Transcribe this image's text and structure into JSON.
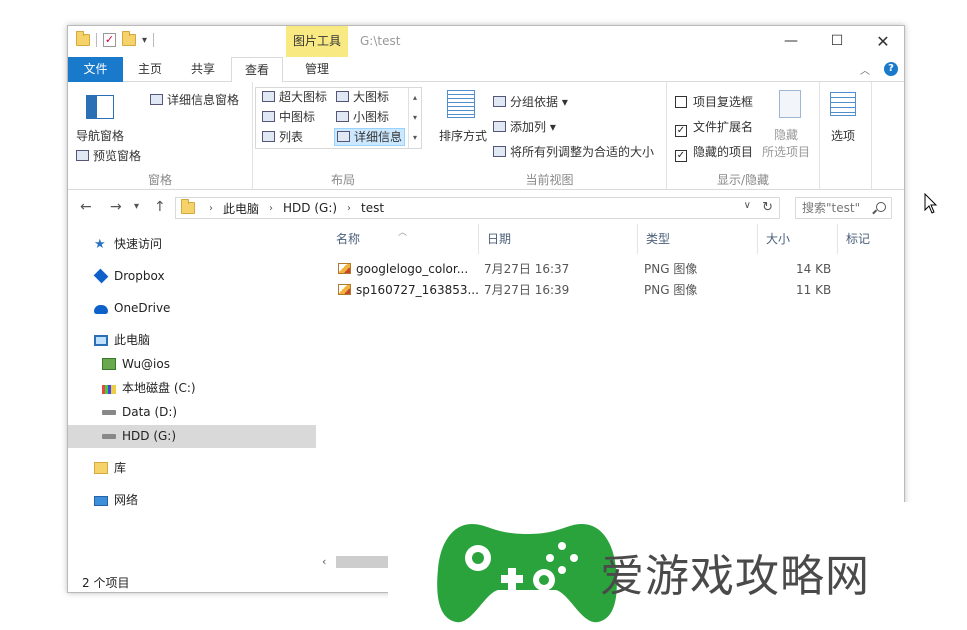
{
  "window": {
    "context_tab": "图片工具",
    "title": "G:\\test"
  },
  "tabs": {
    "file": "文件",
    "home": "主页",
    "share": "共享",
    "view": "查看",
    "manage": "管理"
  },
  "ribbon": {
    "panes": {
      "nav_pane": "导航窗格",
      "preview_pane": "预览窗格",
      "details_pane": "详细信息窗格",
      "group_label": "窗格"
    },
    "layout": {
      "extra_large": "超大图标",
      "large": "大图标",
      "medium": "中图标",
      "small": "小图标",
      "list": "列表",
      "details": "详细信息",
      "group_label": "布局"
    },
    "current_view": {
      "sort_by": "排序方式",
      "group_by": "分组依据",
      "add_columns": "添加列",
      "size_columns": "将所有列调整为合适的大小",
      "group_label": "当前视图"
    },
    "show_hide": {
      "item_checkboxes": "项目复选框",
      "item_checkboxes_checked": false,
      "file_extensions": "文件扩展名",
      "file_extensions_checked": true,
      "hidden_items": "隐藏的项目",
      "hidden_items_checked": true,
      "hide": "隐藏",
      "hide_selected": "所选项目",
      "group_label": "显示/隐藏"
    },
    "options": "选项"
  },
  "address": {
    "crumbs": [
      "此电脑",
      "HDD (G:)",
      "test"
    ],
    "search_placeholder": "搜索\"test\""
  },
  "nav_pane": {
    "quick_access": "快速访问",
    "dropbox": "Dropbox",
    "onedrive": "OneDrive",
    "this_pc": "此电脑",
    "wu_ios": "Wu@ios",
    "local_c": "本地磁盘 (C:)",
    "data_d": "Data (D:)",
    "hdd_g": "HDD (G:)",
    "libraries": "库",
    "network": "网络"
  },
  "columns": {
    "name": "名称",
    "date": "日期",
    "type": "类型",
    "size": "大小",
    "tags": "标记"
  },
  "files": [
    {
      "name": "googlelogo_color...",
      "date": "7月27日 16:37",
      "type": "PNG 图像",
      "size": "14 KB"
    },
    {
      "name": "sp160727_163853...",
      "date": "7月27日 16:39",
      "type": "PNG 图像",
      "size": "11 KB"
    }
  ],
  "status": "2 个项目",
  "watermark_text": "爱游戏攻略网"
}
